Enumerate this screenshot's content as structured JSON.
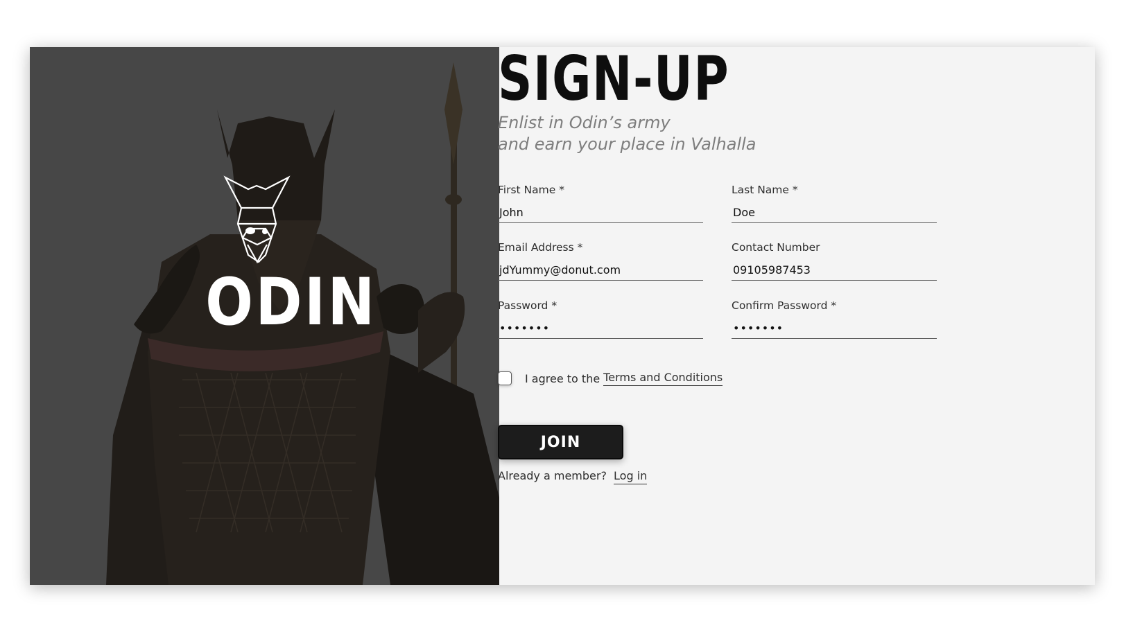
{
  "brand": {
    "logo_text": "ODIN"
  },
  "signup": {
    "title": "SIGN-UP",
    "subtitle_line1": "Enlist in Odin’s army",
    "subtitle_line2": "and earn your place in Valhalla"
  },
  "fields": {
    "first_name": {
      "label": "First Name *",
      "value": "John"
    },
    "last_name": {
      "label": "Last Name *",
      "value": "Doe"
    },
    "email": {
      "label": "Email Address *",
      "value": "jdYummy@donut.com"
    },
    "contact": {
      "label": "Contact Number",
      "value": "09105987453"
    },
    "password": {
      "label": "Password *",
      "value": "•••••••"
    },
    "confirm_password": {
      "label": "Confirm Password *",
      "value": "•••••••"
    }
  },
  "terms": {
    "prefix": "I agree to the",
    "link": "Terms and Conditions",
    "checked": false
  },
  "join_button": "JOIN",
  "login": {
    "prompt": "Already a member?",
    "link": "Log in"
  },
  "colors": {
    "left_panel": "#474747",
    "right_panel": "#f4f4f4",
    "button": "#1c1c1c",
    "subtitle": "#7d7d7d"
  }
}
